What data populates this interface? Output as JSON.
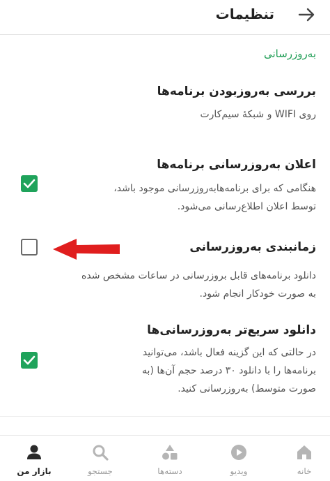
{
  "header": {
    "title": "تنظیمات",
    "back_icon": "arrow-right-icon"
  },
  "section": {
    "title": "به‌روزرسانی"
  },
  "settings": [
    {
      "title": "بررسی به‌روزبودن برنامه‌ها",
      "desc": [
        "روی WIFI و شبکهٔ سیم‌کارت"
      ]
    },
    {
      "title": "اعلان به‌روزرسانی برنامه‌ها",
      "desc": [
        "هنگامی که برای برنامه‌هابه‌روزرسانی موجود باشد،",
        "توسط اعلان اطلاع‌رسانی می‌شود."
      ],
      "checked": true
    },
    {
      "title": "زمانبندی به‌روزرسانی",
      "desc": [
        "دانلود برنامه‌های قابل بروزرسانی در ساعات مشخص شده",
        "به صورت خودکار انجام شود."
      ],
      "checked": false
    },
    {
      "title": "دانلود سریع‌تر به‌روزرسانی‌ها",
      "desc": [
        "در حالتی که این گزینه فعال باشد، می‌توانید",
        "برنامه‌ها را با دانلود ۳۰ درصد حجم آن‌ها (به",
        "صورت متوسط) به‌روزرسانی کنید."
      ],
      "checked": true
    }
  ],
  "colors": {
    "accent": "#1fa35b",
    "section": "#1f9d55",
    "arrow": "#e01e1e"
  },
  "bottom_nav": [
    {
      "label": "خانه",
      "icon": "home-icon"
    },
    {
      "label": "ویدیو",
      "icon": "video-icon"
    },
    {
      "label": "دسته‌ها",
      "icon": "categories-icon"
    },
    {
      "label": "جستجو",
      "icon": "search-icon"
    },
    {
      "label": "بازار من",
      "icon": "user-icon",
      "active": true
    }
  ]
}
